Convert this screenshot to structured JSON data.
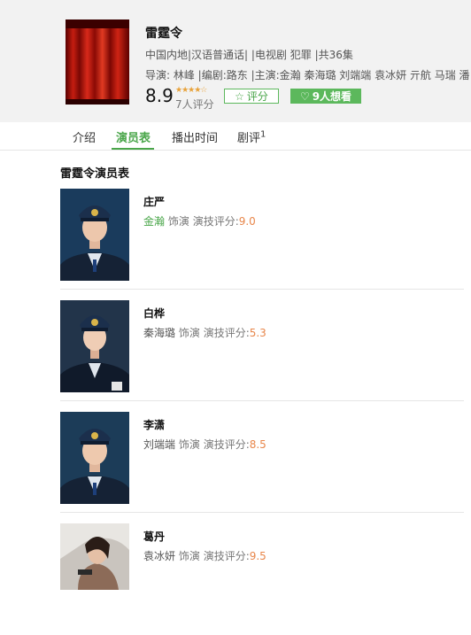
{
  "show": {
    "title": "雷霆令",
    "meta_line1": "中国内地|汉语普通话| |电视剧 犯罪 |共36集",
    "meta_line2": "导演: 林峰 |编剧:路东 |主演:金瀚 秦海璐 刘端端 袁冰妍 亓航 马瑞 潘",
    "score": "8.9",
    "stars": "★★★★☆",
    "votes": "7人评分",
    "rate_button": "评分",
    "want_button": "9人想看"
  },
  "tabs": [
    {
      "label": "介绍"
    },
    {
      "label": "演员表",
      "active": true
    },
    {
      "label": "播出时间"
    },
    {
      "label": "剧评",
      "count": "1"
    }
  ],
  "section_title": "雷霆令演员表",
  "cast": [
    {
      "role": "庄严",
      "actor": "金瀚",
      "played": "饰演",
      "score_label": "演技评分:",
      "score": "9.0",
      "highlight": true
    },
    {
      "role": "白桦",
      "actor": "秦海璐",
      "played": "饰演",
      "score_label": "演技评分:",
      "score": "5.3"
    },
    {
      "role": "李潇",
      "actor": "刘端端",
      "played": "饰演",
      "score_label": "演技评分:",
      "score": "8.5"
    },
    {
      "role": "葛丹",
      "actor": "袁冰妍",
      "played": "饰演",
      "score_label": "演技评分:",
      "score": "9.5"
    }
  ],
  "colors": {
    "accent": "#5cb85c",
    "score": "#e8864a",
    "header_bg": "#f2f2f2"
  },
  "icons": [
    "star-outline-icon",
    "heart-outline-icon"
  ]
}
